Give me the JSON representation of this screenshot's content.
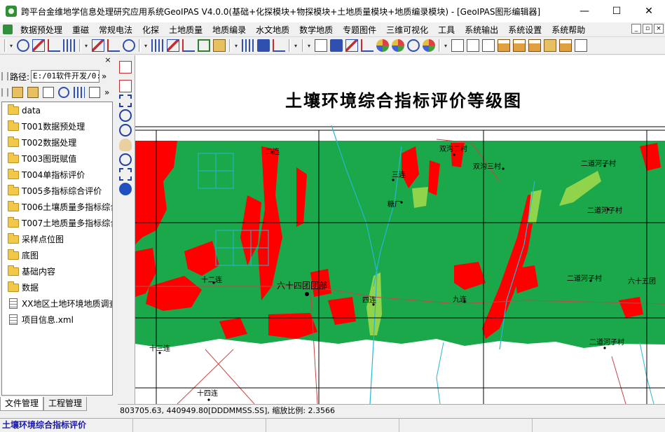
{
  "window": {
    "title": "跨平台金维地学信息处理研究应用系统GeoIPAS V4.0.0(基础+化探模块+物探模块+土地质量模块+地质编录模块) - [GeoIPAS图形编辑器]",
    "minimize": "—",
    "maximize": "☐",
    "close": "✕"
  },
  "menu": {
    "items": [
      "数据预处理",
      "重磁",
      "常规电法",
      "化探",
      "土地质量",
      "地质编录",
      "水文地质",
      "数学地质",
      "专题图件",
      "三维可视化",
      "工具",
      "系统输出",
      "系统设置",
      "系统帮助"
    ],
    "mdi": [
      "_",
      "▫",
      "×"
    ]
  },
  "toolbar": {
    "grid_label": "GRID"
  },
  "left_panel": {
    "close": "×",
    "path_label": "路径:",
    "path_value": "E:/01软件开发/0:",
    "path_go": "»",
    "tools_more": "»",
    "tree": [
      {
        "label": "data",
        "type": "folder"
      },
      {
        "label": "T001数据预处理",
        "type": "folder"
      },
      {
        "label": "T002数据处理",
        "type": "folder"
      },
      {
        "label": "T003图斑赋值",
        "type": "folder"
      },
      {
        "label": "T004单指标评价",
        "type": "folder"
      },
      {
        "label": "T005多指标综合评价",
        "type": "folder"
      },
      {
        "label": "T006土壤质量多指标综合",
        "type": "folder"
      },
      {
        "label": "T007土地质量多指标综合",
        "type": "folder"
      },
      {
        "label": "采样点位图",
        "type": "folder"
      },
      {
        "label": "底图",
        "type": "folder"
      },
      {
        "label": "基础内容",
        "type": "folder"
      },
      {
        "label": "数据",
        "type": "folder"
      },
      {
        "label": "XX地区土地环境地质调查",
        "type": "file"
      },
      {
        "label": "项目信息.xml",
        "type": "file"
      }
    ],
    "tabs": [
      "文件管理",
      "工程管理"
    ]
  },
  "map": {
    "title": "土壤环境综合指标评价等级图",
    "labels": {
      "er_lian": "二连",
      "shuanggou_er": "双沟二村",
      "shuanggou_san": "双沟三村",
      "san_lian": "三连",
      "tang_chang": "糖厂",
      "erdao_1": "二道河子村",
      "erdao_2": "二道河子村",
      "shier_lian": "十二连",
      "tuanbu": "六十四团团部",
      "si_lian": "四连",
      "jiu_lian": "九连",
      "erdao_3": "二道河子村",
      "liushiwu": "六十五团",
      "shisan_lian": "十三连",
      "erdao_4": "二道河子村",
      "shisi_lian": "十四连"
    },
    "colors": {
      "green": "#1aa84a",
      "red": "#ff0000",
      "light_green": "#8fd44a",
      "river": "#29b6d6",
      "road": "#c84646"
    }
  },
  "coord_bar": "803705.63, 440949.80[DDDMMSS.SS], 缩放比例: 2.3566",
  "status": {
    "text": "土壤环境综合指标评价"
  }
}
